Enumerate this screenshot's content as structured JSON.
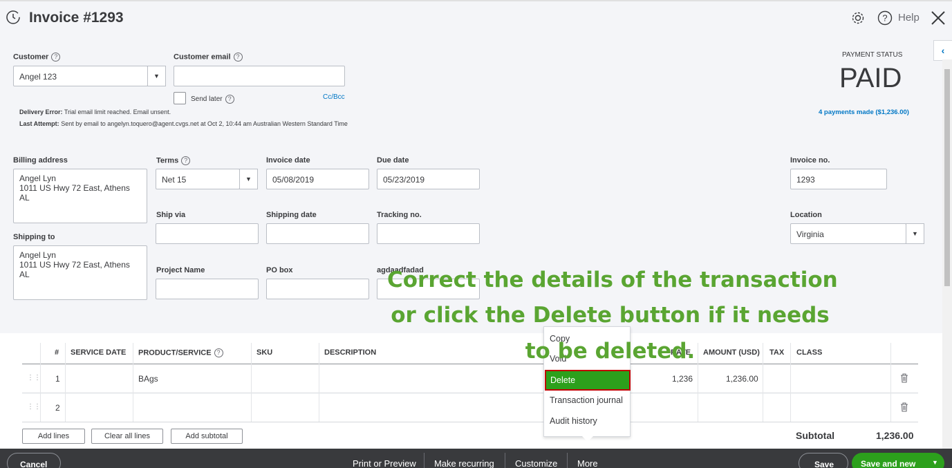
{
  "header": {
    "title": "Invoice #1293",
    "help_label": "Help"
  },
  "customer": {
    "label": "Customer",
    "value": "Angel 123",
    "email_label": "Customer email",
    "email_value": "",
    "send_later_label": "Send later",
    "cc_bcc": "Cc/Bcc",
    "delivery_error_label": "Delivery Error:",
    "delivery_error_text": "Trial email limit reached. Email unsent.",
    "last_attempt_label": "Last Attempt:",
    "last_attempt_text": "Sent by email to angelyn.toquero@agent.cvgs.net at Oct 2, 10:44 am Australian Western Standard Time"
  },
  "payment": {
    "status_label": "PAYMENT STATUS",
    "status": "PAID",
    "payments_link": "4 payments made ($1,236.00)"
  },
  "form": {
    "billing_label": "Billing address",
    "billing_value": "Angel Lyn\n1011 US Hwy 72 East, Athens AL",
    "shipping_label": "Shipping to",
    "shipping_value": "Angel Lyn\n1011 US Hwy 72 East, Athens AL",
    "terms_label": "Terms",
    "terms_value": "Net 15",
    "invoice_date_label": "Invoice date",
    "invoice_date_value": "05/08/2019",
    "due_date_label": "Due date",
    "due_date_value": "05/23/2019",
    "invoice_no_label": "Invoice no.",
    "invoice_no_value": "1293",
    "ship_via_label": "Ship via",
    "shipping_date_label": "Shipping date",
    "tracking_label": "Tracking no.",
    "location_label": "Location",
    "location_value": "Virginia",
    "project_label": "Project Name",
    "po_label": "PO box",
    "custom_label": "agdaadfadad"
  },
  "table": {
    "columns": [
      "#",
      "SERVICE DATE",
      "PRODUCT/SERVICE",
      "SKU",
      "DESCRIPTION",
      "RATE",
      "AMOUNT (USD)",
      "TAX",
      "CLASS"
    ],
    "rows": [
      {
        "num": "1",
        "product": "BAgs",
        "rate": "1,236",
        "amount": "1,236.00"
      },
      {
        "num": "2",
        "product": "",
        "rate": "",
        "amount": ""
      }
    ],
    "add_lines": "Add lines",
    "clear_all_lines": "Clear all lines",
    "add_subtotal": "Add subtotal",
    "subtotal_label": "Subtotal",
    "subtotal_value": "1,236.00"
  },
  "more_menu": {
    "items": [
      "Copy",
      "Void",
      "Delete",
      "Transaction journal",
      "Audit history"
    ]
  },
  "footer": {
    "cancel": "Cancel",
    "print_preview": "Print or Preview",
    "make_recurring": "Make recurring",
    "customize": "Customize",
    "more": "More",
    "save": "Save",
    "save_and_new": "Save and new"
  },
  "overlay": {
    "line1": "Correct the details of the transaction",
    "line2": "or click the Delete button if it needs",
    "line3": "to be deleted."
  },
  "colors": {
    "accent_green": "#2ca01c",
    "highlight_border": "#c00000",
    "link_blue": "#0077c5",
    "overlay_text": "#5aa532"
  }
}
